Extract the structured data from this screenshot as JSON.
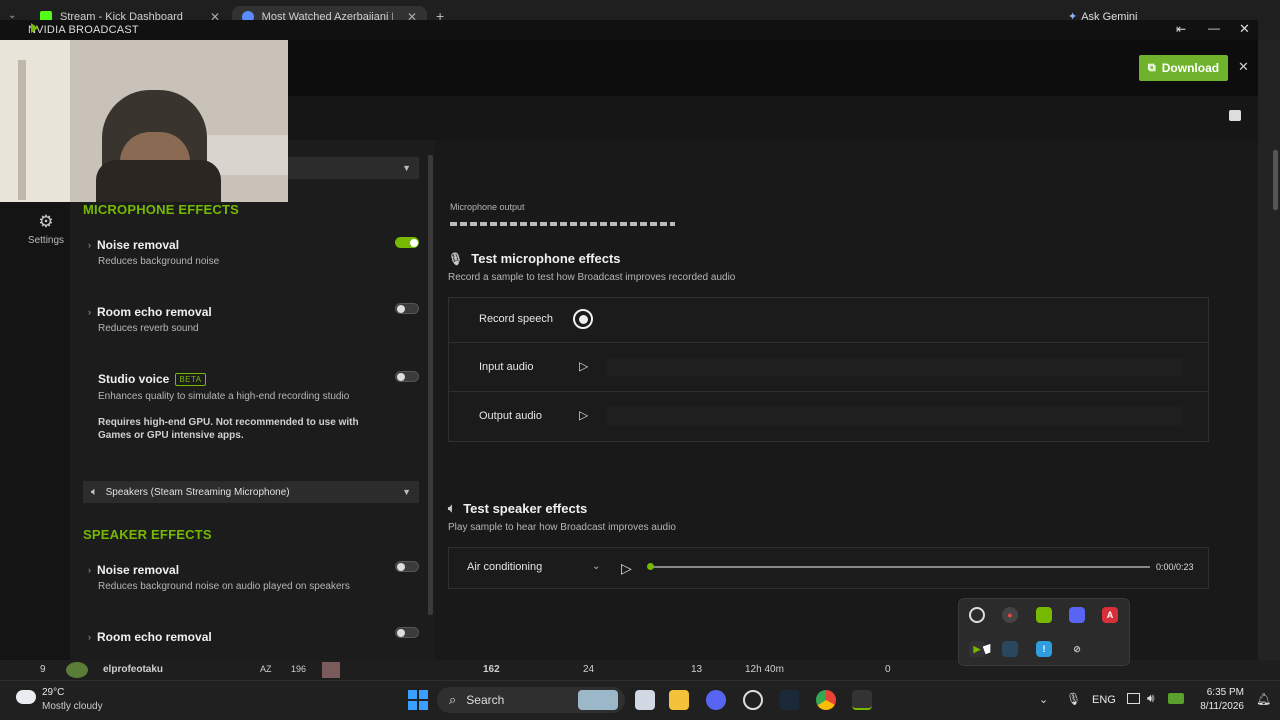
{
  "browser": {
    "tabs": [
      {
        "label": "Stream - Kick Dashboard",
        "favicon_color": "#53fc18"
      },
      {
        "label": "Most Watched Azerbaijani Kick",
        "favicon_color": "#5b8cff"
      }
    ],
    "new_tab": "+",
    "gemini": "Ask Gemini"
  },
  "broadcast": {
    "app_title": "NVIDIA BROADCAST",
    "download_label": "Download",
    "nav": {
      "settings_label": "Settings"
    },
    "microphone": {
      "section_title": "MICROPHONE EFFECTS",
      "effects": [
        {
          "name": "Noise removal",
          "desc": "Reduces background noise",
          "enabled": true
        },
        {
          "name": "Room echo removal",
          "desc": "Reduces reverb sound",
          "enabled": false
        },
        {
          "name": "Studio voice",
          "badge": "BETA",
          "desc": "Enhances quality to simulate a high-end recording studio",
          "warning": "Requires high-end GPU. Not recommended to use with Games or GPU intensive apps.",
          "enabled": false
        }
      ]
    },
    "speaker_device": "Speakers (Steam Streaming Microphone)",
    "speaker": {
      "section_title": "SPEAKER EFFECTS",
      "effects": [
        {
          "name": "Noise removal",
          "desc": "Reduces background noise on audio played on speakers",
          "enabled": false
        },
        {
          "name": "Room echo removal",
          "enabled": false
        }
      ]
    },
    "main": {
      "mic_output_label": "Microphone output",
      "test_mic_title": "Test microphone effects",
      "test_mic_sub": "Record a sample to test how Broadcast improves recorded audio",
      "record_label": "Record speech",
      "input_label": "Input audio",
      "output_label": "Output audio",
      "test_speaker_title": "Test speaker effects",
      "test_speaker_sub": "Play sample to hear how Broadcast improves audio",
      "sample_select": "Air conditioning",
      "time": "0:00/0:23",
      "progress": 0
    }
  },
  "leaderboard_row": {
    "rank": "9",
    "name": "elprofeotaku",
    "lang": "AZ",
    "v1": "196",
    "viewers": "162",
    "v2": "24",
    "v3": "13",
    "duration": "12h 40m",
    "v4": "0"
  },
  "taskbar": {
    "weather_temp": "29°C",
    "weather_desc": "Mostly cloudy",
    "search_placeholder": "Search",
    "lang": "ENG",
    "time": "6:35 PM",
    "date": "8/11/2026"
  },
  "colors": {
    "accent": "#76b900",
    "download": "#6fb32c"
  }
}
